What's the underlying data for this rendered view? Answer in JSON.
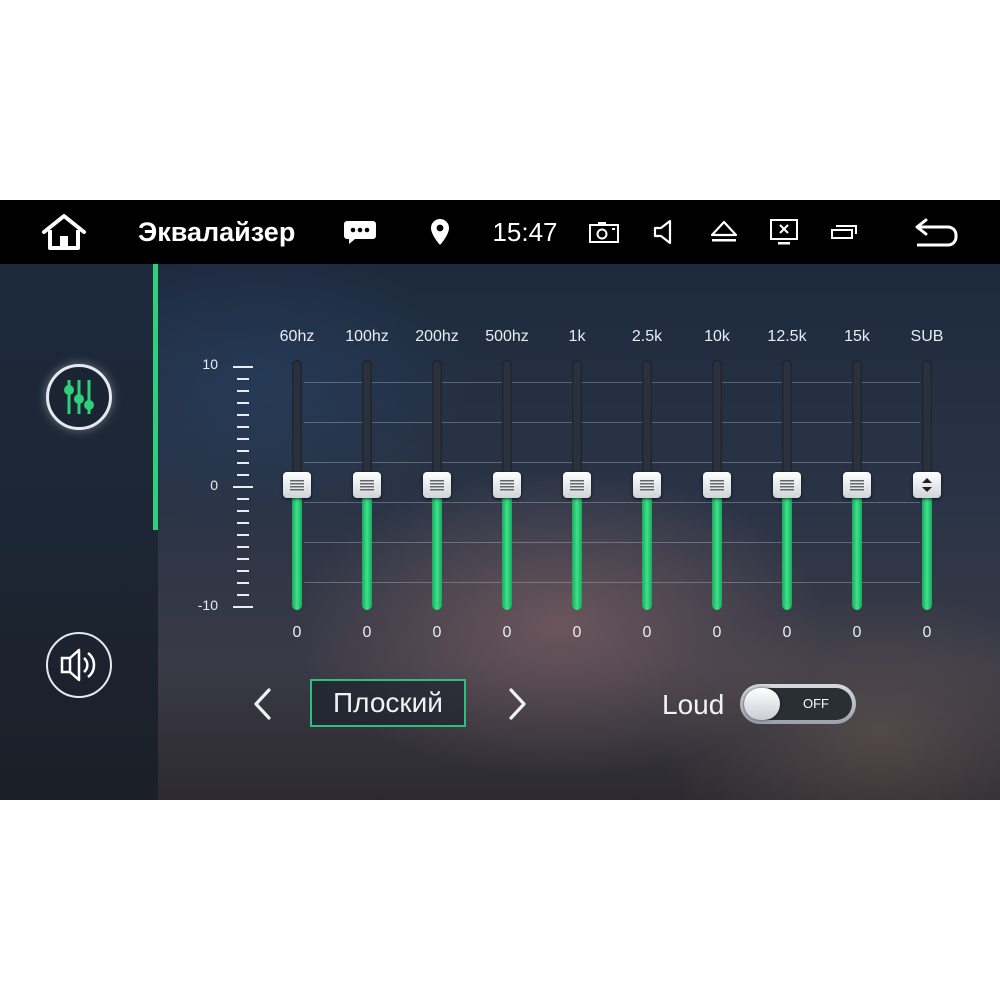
{
  "status_bar": {
    "title": "Эквалайзер",
    "time": "15:47",
    "icons": [
      "home-icon",
      "message-icon",
      "location-pin-icon",
      "camera-icon",
      "volume-icon",
      "eject-icon",
      "screen-off-icon",
      "recent-apps-icon",
      "back-icon"
    ]
  },
  "sidebar": {
    "items": [
      {
        "name": "equalizer",
        "icon": "equalizer-sliders-icon",
        "active": true
      },
      {
        "name": "sound-field",
        "icon": "speaker-icon",
        "active": false
      }
    ]
  },
  "equalizer": {
    "scale": {
      "max": "10",
      "zero": "0",
      "min": "-10"
    },
    "range": [
      -10,
      10
    ],
    "bands": [
      {
        "label": "60hz",
        "value": "0",
        "level": 0
      },
      {
        "label": "100hz",
        "value": "0",
        "level": 0
      },
      {
        "label": "200hz",
        "value": "0",
        "level": 0
      },
      {
        "label": "500hz",
        "value": "0",
        "level": 0
      },
      {
        "label": "1k",
        "value": "0",
        "level": 0
      },
      {
        "label": "2.5k",
        "value": "0",
        "level": 0
      },
      {
        "label": "10k",
        "value": "0",
        "level": 0
      },
      {
        "label": "12.5k",
        "value": "0",
        "level": 0
      },
      {
        "label": "15k",
        "value": "0",
        "level": 0
      },
      {
        "label": "SUB",
        "value": "0",
        "level": 0
      }
    ]
  },
  "preset": {
    "label": "Плоский"
  },
  "loud": {
    "label": "Loud",
    "state": "OFF"
  },
  "colors": {
    "accent": "#2ed07a",
    "background": "#1d2a3d",
    "status_bar": "#000000"
  }
}
